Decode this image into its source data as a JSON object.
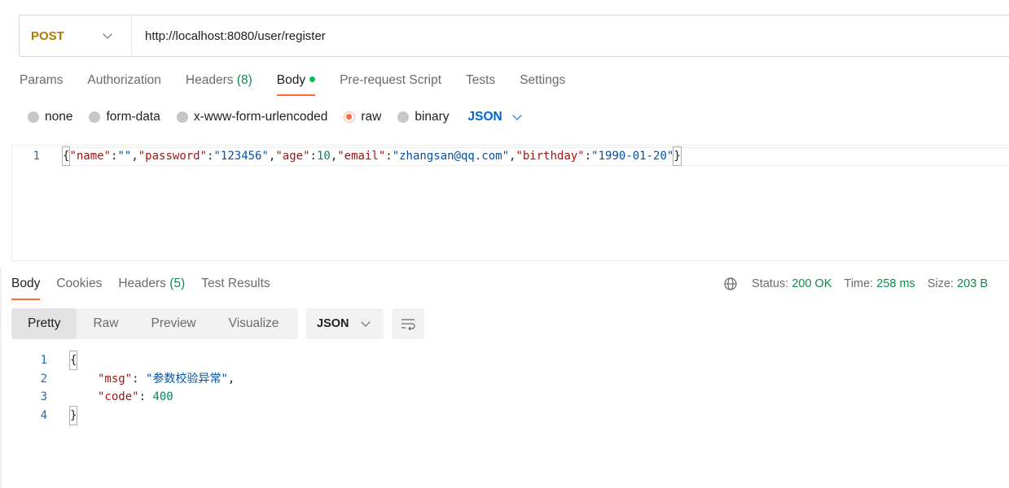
{
  "request": {
    "method": "POST",
    "url": "http://localhost:8080/user/register"
  },
  "request_tabs": [
    {
      "label": "Params"
    },
    {
      "label": "Authorization"
    },
    {
      "label": "Headers",
      "count": "(8)"
    },
    {
      "label": "Body",
      "active": true,
      "indicator": "green-dot"
    },
    {
      "label": "Pre-request Script"
    },
    {
      "label": "Tests"
    },
    {
      "label": "Settings"
    }
  ],
  "body_types": [
    {
      "label": "none",
      "checked": false
    },
    {
      "label": "form-data",
      "checked": false
    },
    {
      "label": "x-www-form-urlencoded",
      "checked": false
    },
    {
      "label": "raw",
      "checked": true
    },
    {
      "label": "binary",
      "checked": false
    }
  ],
  "body_format": "JSON",
  "request_body": {
    "line_number": "1",
    "tokens": {
      "open": "{",
      "k1": "\"name\"",
      "c1": ":",
      "v1": "\"\"",
      "sep1": ",",
      "k2": "\"password\"",
      "c2": ":",
      "v2": "\"123456\"",
      "sep2": ",",
      "k3": "\"age\"",
      "c3": ":",
      "v3": "10",
      "sep3": ",",
      "k4": "\"email\"",
      "c4": ":",
      "v4": "\"zhangsan@qq.com\"",
      "sep4": ",",
      "k5": "\"birthday\"",
      "c5": ":",
      "v5": "\"1990-01-20\"",
      "close": "}"
    }
  },
  "response_tabs": [
    {
      "label": "Body",
      "active": true
    },
    {
      "label": "Cookies"
    },
    {
      "label": "Headers",
      "count": "(5)"
    },
    {
      "label": "Test Results"
    }
  ],
  "response_status": {
    "status_label": "Status:",
    "status_value": "200 OK",
    "time_label": "Time:",
    "time_value": "258 ms",
    "size_label": "Size:",
    "size_value": "203 B",
    "accent_color": "#0f8a4a"
  },
  "response_views": [
    {
      "label": "Pretty",
      "active": true
    },
    {
      "label": "Raw"
    },
    {
      "label": "Preview"
    },
    {
      "label": "Visualize"
    }
  ],
  "response_format": "JSON",
  "response_body": {
    "lines": [
      "1",
      "2",
      "3",
      "4"
    ],
    "open": "{",
    "msg_key": "\"msg\"",
    "msg_colon": ": ",
    "msg_value": "\"参数校验异常\"",
    "msg_sep": ",",
    "code_key": "\"code\"",
    "code_colon": ": ",
    "code_value": "400",
    "close": "}"
  },
  "colors": {
    "accent_orange": "#ff6c37",
    "method_post": "#ad7a03",
    "link_blue": "#0265d2",
    "status_green": "#0f8a4a"
  }
}
